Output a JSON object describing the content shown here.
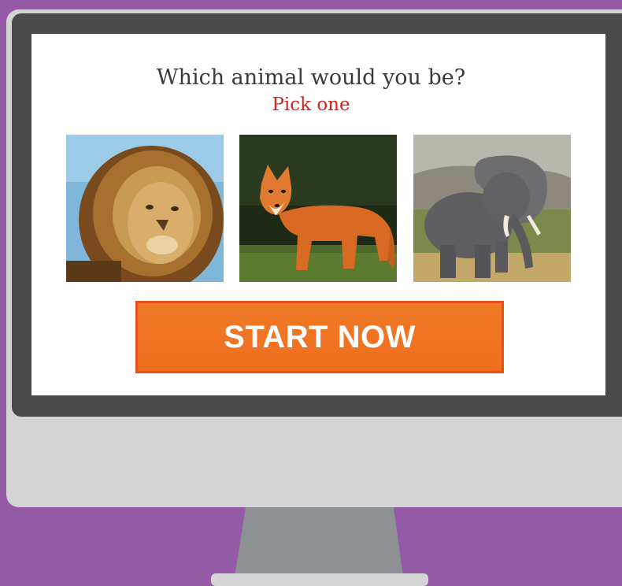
{
  "quiz": {
    "title": "Which animal would you be?",
    "subtitle": "Pick one",
    "options": [
      {
        "name": "lion",
        "icon": "lion-photo"
      },
      {
        "name": "fox",
        "icon": "fox-photo"
      },
      {
        "name": "elephant",
        "icon": "elephant-photo"
      }
    ],
    "cta_label": "START NOW"
  },
  "colors": {
    "background": "#945aa6",
    "monitor_body": "#d4d4d4",
    "bezel": "#4a4a4a",
    "stand": "#8e9194",
    "title": "#3b3b3b",
    "subtitle": "#d32424",
    "cta": "#f07a27"
  }
}
